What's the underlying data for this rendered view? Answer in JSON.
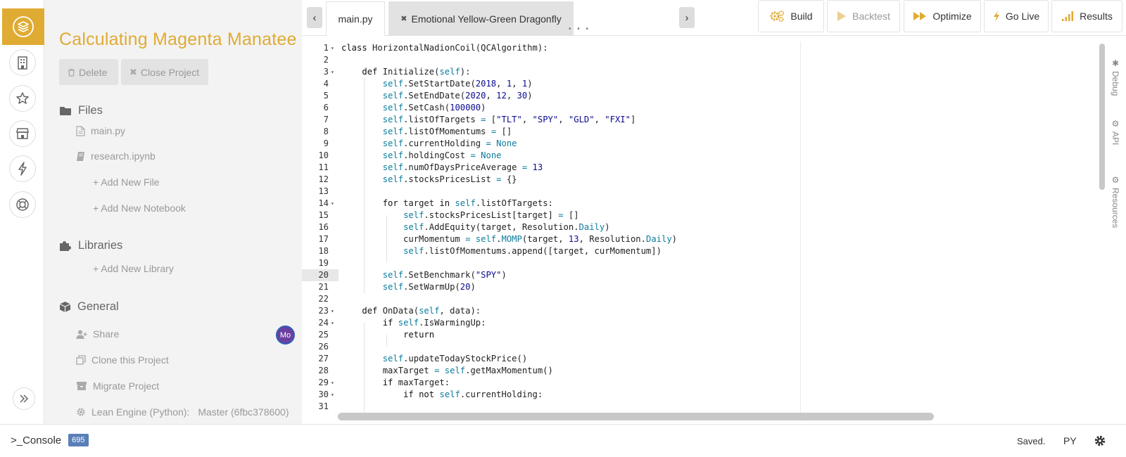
{
  "project": {
    "title": "Calculating Magenta Manatee",
    "delete_label": "Delete",
    "close_label": "Close Project",
    "files_label": "Files",
    "files": [
      "main.py",
      "research.ipynb"
    ],
    "add_file": "+ Add New File",
    "add_notebook": "+ Add New Notebook",
    "libraries_label": "Libraries",
    "add_library": "+ Add New Library",
    "general_label": "General",
    "share": "Share",
    "share_avatar": "Mo",
    "clone": "Clone this Project",
    "migrate": "Migrate Project",
    "lean_engine_label": "Lean Engine (Python):",
    "lean_engine_value": "Master (6fbc378600)"
  },
  "tabs": {
    "active": "main.py",
    "other": "Emotional Yellow-Green Dragonfly",
    "other_dots": "• • •"
  },
  "toolbar": {
    "build": "Build",
    "backtest": "Backtest",
    "optimize": "Optimize",
    "go_live": "Go Live",
    "results": "Results"
  },
  "side_tabs": {
    "debug": "Debug",
    "api": "API",
    "resources": "Resources"
  },
  "editor": {
    "active_line": 20,
    "lines": [
      "class HorizontalNadionCoil(QCAlgorithm):",
      "",
      "    def Initialize(self):",
      "        self.SetStartDate(2018, 1, 1)",
      "        self.SetEndDate(2020, 12, 30)",
      "        self.SetCash(100000)",
      "        self.listOfTargets = [\"TLT\", \"SPY\", \"GLD\", \"FXI\"]",
      "        self.listOfMomentums = []",
      "        self.currentHolding = None",
      "        self.holdingCost = None",
      "        self.numOfDaysPriceAverage = 13",
      "        self.stocksPricesList = {}",
      "",
      "        for target in self.listOfTargets:",
      "            self.stocksPricesList[target] = []",
      "            self.AddEquity(target, Resolution.Daily)",
      "            curMomentum = self.MOMP(target, 13, Resolution.Daily)",
      "            self.listOfMomentums.append([target, curMomentum])",
      "",
      "        self.SetBenchmark(\"SPY\")",
      "        self.SetWarmUp(20)",
      "",
      "    def OnData(self, data):",
      "        if self.IsWarmingUp:",
      "            return",
      "",
      "        self.updateTodayStockPrice()",
      "        maxTarget = self.getMaxMomentum()",
      "        if maxTarget:",
      "            if not self.currentHolding:",
      ""
    ],
    "fold_lines": [
      1,
      3,
      14,
      23,
      24,
      29,
      30
    ]
  },
  "status": {
    "console_label": ">_Console",
    "console_count": "695",
    "saved": "Saved.",
    "language": "PY"
  },
  "colors": {
    "accent": "#e0ab33",
    "panel_bg": "#f3f3f3",
    "badge": "#5a7fb8",
    "avatar": "#6b3fa0"
  }
}
